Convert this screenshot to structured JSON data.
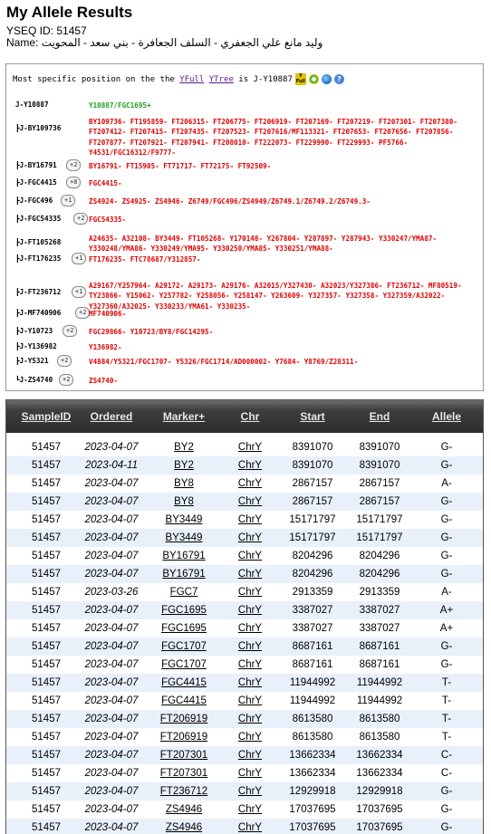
{
  "page": {
    "title": "My Allele Results",
    "yseq_id_label": "YSEQ ID:",
    "yseq_id": "51457",
    "name_label": "Name:",
    "name": "وليد مانع علي الجعفري - السلف الجعافرة - بني سعد - المحويت"
  },
  "tree": {
    "header_prefix": "Most specific position on the",
    "yfull_link": "YFull",
    "ytree_link": "YTree",
    "header_is": "is",
    "position": "J-Y10887",
    "icons": [
      "yfull-icon",
      "yfull-ring-icon",
      "globe-icon",
      "help-icon"
    ],
    "rows": [
      {
        "name": "J-Y10887",
        "badge": "",
        "green": true,
        "snps": "Y10887/FGC1695+"
      },
      {
        "name": "┣J-BY109736",
        "badge": "",
        "green": false,
        "snps": "BY109736- FT195859- FT206315- FT206775- FT206919- FT207169- FT207219- FT207301- FT207380- FT207412- FT207415- FT207435- FT207523- FT207616/MF113321- FT207653- FT207656- FT207856- FT207877- FT207921- FT207941- FT208010- FT222073- FT229990- FT229993- PF5766- Y4531/FGC16312/F9777-"
      },
      {
        "name": "┣J-BY16791",
        "badge": "+2",
        "green": false,
        "snps": "BY16791- FT15905- FT71717- FT72175- FT92509-"
      },
      {
        "name": "┣J-FGC4415",
        "badge": "+8",
        "green": false,
        "snps": "FGC4415-"
      },
      {
        "name": "┣J-FGC496",
        "badge": "+1",
        "green": false,
        "snps": "ZS4924- ZS4925- ZS4946- Z6749/FGC496/ZS4949/Z6749.1/Z6749.2/Z6749.3-"
      },
      {
        "name": "┣J-FGC54335",
        "badge": "+2",
        "green": false,
        "snps": "FGC54335-"
      },
      {
        "name": "┣J-FT105268",
        "badge": "",
        "green": false,
        "snps": "A24635- A32108- BY3449- FT105268- Y170148- Y267804- Y287897- Y287943- Y330247/YMA87- Y330248/YMA86- Y330249/YMA95- Y330250/YMA85- Y330251/YMA88-"
      },
      {
        "name": "┣J-FT176235",
        "badge": "+1",
        "green": false,
        "snps": "FT176235- FTC78687/Y312857-"
      },
      {
        "name": "┣J-FT236712",
        "badge": "+1",
        "green": false,
        "snps": "A29167/Y257964- A29172- A29173- A29176- A32015/Y327430- A32023/Y327386- FT236712- MF80519- TY23866- Y15062- Y257782- Y258056- Y258147- Y263609- Y327357- Y327358- Y327359/A32022- Y327360/A32025- Y330233/YMA61- Y330235-"
      },
      {
        "name": "┣J-MF740906",
        "badge": "+2",
        "green": false,
        "snps": "MF740906-"
      },
      {
        "name": "┣J-Y10723",
        "badge": "+2",
        "green": false,
        "snps": "FGC29866- Y10723/BY8/FGC14295-"
      },
      {
        "name": "┣J-Y136982",
        "badge": "",
        "green": false,
        "snps": "Y136982-"
      },
      {
        "name": "┣J-Y5321",
        "badge": "+2",
        "green": false,
        "snps": "V4884/Y5321/FGC1707- Y5326/FGC1714/AD000002- Y7684- Y8769/Z28311-"
      },
      {
        "name": "┗J-ZS4740",
        "badge": "+2",
        "green": false,
        "snps": "ZS4740-"
      }
    ]
  },
  "table": {
    "headers": [
      "SampleID",
      "Ordered",
      "Marker+",
      "Chr",
      "Start",
      "End",
      "Allele"
    ],
    "rows": [
      [
        "51457",
        "2023-04-07",
        "BY2",
        "ChrY",
        "8391070",
        "8391070",
        "G-"
      ],
      [
        "51457",
        "2023-04-11",
        "BY2",
        "ChrY",
        "8391070",
        "8391070",
        "G-"
      ],
      [
        "51457",
        "2023-04-07",
        "BY8",
        "ChrY",
        "2867157",
        "2867157",
        "A-"
      ],
      [
        "51457",
        "2023-04-07",
        "BY8",
        "ChrY",
        "2867157",
        "2867157",
        "G-"
      ],
      [
        "51457",
        "2023-04-07",
        "BY3449",
        "ChrY",
        "15171797",
        "15171797",
        "G-"
      ],
      [
        "51457",
        "2023-04-07",
        "BY3449",
        "ChrY",
        "15171797",
        "15171797",
        "G-"
      ],
      [
        "51457",
        "2023-04-07",
        "BY16791",
        "ChrY",
        "8204296",
        "8204296",
        "G-"
      ],
      [
        "51457",
        "2023-04-07",
        "BY16791",
        "ChrY",
        "8204296",
        "8204296",
        "G-"
      ],
      [
        "51457",
        "2023-03-26",
        "FGC7",
        "ChrY",
        "2913359",
        "2913359",
        "A-"
      ],
      [
        "51457",
        "2023-04-07",
        "FGC1695",
        "ChrY",
        "3387027",
        "3387027",
        "A+"
      ],
      [
        "51457",
        "2023-04-07",
        "FGC1695",
        "ChrY",
        "3387027",
        "3387027",
        "A+"
      ],
      [
        "51457",
        "2023-04-07",
        "FGC1707",
        "ChrY",
        "8687161",
        "8687161",
        "G-"
      ],
      [
        "51457",
        "2023-04-07",
        "FGC1707",
        "ChrY",
        "8687161",
        "8687161",
        "G-"
      ],
      [
        "51457",
        "2023-04-07",
        "FGC4415",
        "ChrY",
        "11944992",
        "11944992",
        "T-"
      ],
      [
        "51457",
        "2023-04-07",
        "FGC4415",
        "ChrY",
        "11944992",
        "11944992",
        "T-"
      ],
      [
        "51457",
        "2023-04-07",
        "FT206919",
        "ChrY",
        "8613580",
        "8613580",
        "T-"
      ],
      [
        "51457",
        "2023-04-07",
        "FT206919",
        "ChrY",
        "8613580",
        "8613580",
        "T-"
      ],
      [
        "51457",
        "2023-04-07",
        "FT207301",
        "ChrY",
        "13662334",
        "13662334",
        "C-"
      ],
      [
        "51457",
        "2023-04-07",
        "FT207301",
        "ChrY",
        "13662334",
        "13662334",
        "C-"
      ],
      [
        "51457",
        "2023-04-07",
        "FT236712",
        "ChrY",
        "12929918",
        "12929918",
        "G-"
      ],
      [
        "51457",
        "2023-04-07",
        "ZS4946",
        "ChrY",
        "17037695",
        "17037695",
        "G-"
      ],
      [
        "51457",
        "2023-04-07",
        "ZS4946",
        "ChrY",
        "17037695",
        "17037695",
        "G-"
      ]
    ]
  }
}
